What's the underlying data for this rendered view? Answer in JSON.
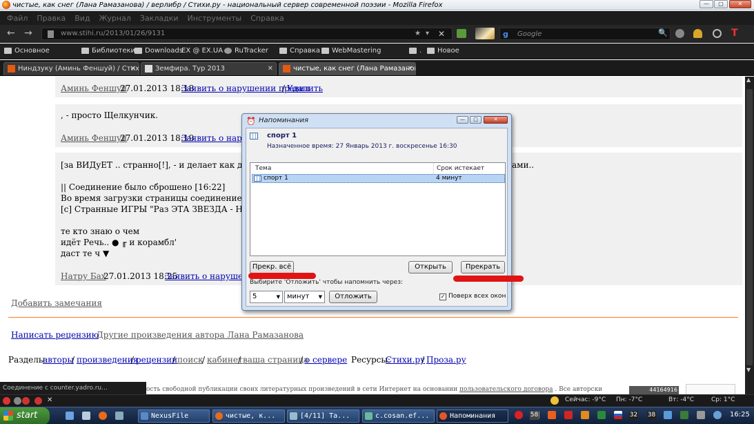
{
  "window": {
    "title": "чистые, как снег (Лана Рамазанова) / верлибр / Стихи.ру - национальный сервер современной поэзии - Mozilla Firefox",
    "min": "—",
    "max": "□",
    "close": "✕"
  },
  "menu": [
    "Файл",
    "Правка",
    "Вид",
    "Журнал",
    "Закладки",
    "Инструменты",
    "Справка"
  ],
  "nav": {
    "back": "←",
    "forward": "→",
    "url": "www.stihi.ru/2013/01/26/9131",
    "star": "★",
    "dropdown": "▾",
    "stop": "✕",
    "search_engine_letter": "g",
    "search_placeholder": "Google",
    "search_icon": "🔍"
  },
  "bookmarks": [
    "Основное",
    "Библиотеки",
    "Downloads",
    "EX @ EX.UA",
    "RuTracker",
    "Справка",
    "WebMastering",
    ".",
    "Новое"
  ],
  "tabs": [
    {
      "label": "Ниндзуку (Аминь Феншуй) / Стих...",
      "close": "✕"
    },
    {
      "label": "Земфира. Тур 2013",
      "close": "✕"
    },
    {
      "label": "чистые, как снег (Лана Рамазанов...",
      "close": "✕"
    }
  ],
  "page": {
    "comment1": {
      "author": "Аминь Феншуй",
      "date": "27.01.2013 18:18",
      "report": "Заявить о нарушении правил",
      "sep": "/",
      "delete": "Удалить"
    },
    "comment2": {
      "text": ", - просто Щелкунчик.",
      "author": "Аминь Феншуй",
      "date": "27.01.2013 18:19",
      "report": "Заявить о наруше"
    },
    "comment3": {
      "lines": [
        "[за ВИДуЕТ .. странно[!], - и делает как делает",
        "|| Соединение было сброшено [16:22]",
        "Во время загрузки страницы соединение с серв",
        "[с] Странные ИГРЫ \"Раз ЭТА ЗВЕЗДА - НЕ га",
        "те кто знаю о чем",
        "идёт Речь.. ● ╓ и корамбл'",
        "даст те ч ▼"
      ],
      "tail": "ами..",
      "author": "Натру Бах",
      "date": "27.01.2013 18:25",
      "report": "Заявить о нарушении п"
    },
    "add_note": "Добавить замечания",
    "write_review": "Написать рецензию",
    "other_works": "Другие произведения автора Лана Рамазанова",
    "sections_label": "Разделы:",
    "sections": [
      "авторы",
      "произведения",
      "рецензии",
      "поиск",
      "кабинет",
      "ваша страница",
      "о сервере"
    ],
    "resources_label": "Ресурсы:",
    "resources": [
      "Стихи.ру",
      "Проза.ру"
    ],
    "footer": "ость свободной публикации своих литературных произведений в сети Интернет на основании",
    "footer_link": "пользовательского договора",
    "footer_end": ". Все авторские права на произведения",
    "counter": "44164916"
  },
  "dialog": {
    "title": "Напоминания",
    "event_name": "спорт 1",
    "event_time": "Назначенное время: 27 Январь 2013 г. воскресенье 16:30",
    "col_subject": "Тема",
    "col_due": "Срок истекает",
    "rows": [
      {
        "subject": "спорт 1",
        "due": "4 минут"
      }
    ],
    "dismiss_all": "Прекр. всё",
    "open": "Открыть",
    "dismiss": "Прекрать",
    "snooze_label": "Выбирите 'Отложить' чтобы напомнить через:",
    "snooze_value": "5",
    "snooze_unit": "минут",
    "snooze_button": "Отложить",
    "always_on_top": "Поверх всех окон",
    "always_on_top_checked": true
  },
  "status": {
    "text": "Соединение с counter.yadro.ru..."
  },
  "addon_bar": {
    "weather_now": "Сейчас: -9°C",
    "weather_mon": "Пн: -7°C",
    "weather_tue": "Вт: -4°C",
    "weather_wed": "Ср: 1°C"
  },
  "taskbar": {
    "start": "start",
    "items": [
      {
        "label": "NexusFile"
      },
      {
        "label": "чистые, к..."
      },
      {
        "label": "[4/11] Та..."
      },
      {
        "label": "c.cosan.ef..."
      },
      {
        "label": "Напоминания"
      }
    ],
    "tray_numbers": [
      "58",
      "32",
      "38"
    ],
    "clock": "16:25"
  },
  "colors": {
    "accent": "#ff7a1a",
    "link": "#0000b0",
    "taskbar": "#1f3454",
    "dialog_frame": "#cfe0f4",
    "redact": "#e01414"
  }
}
